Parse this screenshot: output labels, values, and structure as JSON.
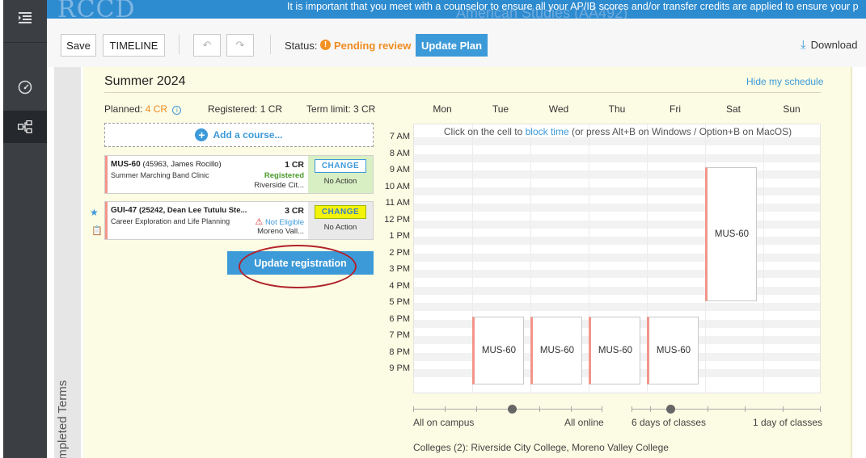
{
  "banner": {
    "logo": "RCCD",
    "ghost_title": "American Studies (AA492)",
    "message": "It is important that you meet with a counselor to ensure all your AP/IB scores and/or transfer credits are applied to ensure your p"
  },
  "rail": {
    "icons": [
      "menu-list-icon",
      "dashboard-gauge-icon",
      "plan-tree-icon"
    ]
  },
  "toolbar": {
    "save_label": "Save",
    "timeline_label": "TIMELINE",
    "undo_icon": "undo-icon",
    "redo_icon": "redo-icon",
    "status_label": "Status:",
    "status_value": "Pending review",
    "status_color": "#f39224",
    "update_plan_label": "Update Plan",
    "download_label": "Download"
  },
  "completed_terms_label": "Completed Terms",
  "term": {
    "title": "Summer 2024",
    "hide_schedule_label": "Hide my schedule",
    "planned_label": "Planned:",
    "planned_value": "4 CR",
    "registered_label": "Registered: 1 CR",
    "term_limit_label": "Term limit: 3 CR",
    "add_course_label": "Add a course...",
    "update_registration_label": "Update registration"
  },
  "courses": [
    {
      "code": "MUS-60",
      "detail": "(45963, James Rocillo)",
      "title": "Summer Marching Band Clinic",
      "credits": "1 CR",
      "status": "Registered",
      "campus": "Riverside Cit...",
      "change_label": "CHANGE",
      "action_label": "No Action"
    },
    {
      "code": "GUI-47",
      "detail": "(25242, Dean Lee Tutulu Ste...",
      "title": "Career Exploration and Life Planning",
      "credits": "3 CR",
      "status": "Not Eligible",
      "campus": "Moreno Vall...",
      "change_label": "CHANGE",
      "action_label": "No Action"
    }
  ],
  "schedule": {
    "days": [
      "Mon",
      "Tue",
      "Wed",
      "Thu",
      "Fri",
      "Sat",
      "Sun"
    ],
    "hours": [
      "7 AM",
      "8 AM",
      "9 AM",
      "10 AM",
      "11 AM",
      "12 PM",
      "1 PM",
      "2 PM",
      "3 PM",
      "4 PM",
      "5 PM",
      "6 PM",
      "7 PM",
      "8 PM",
      "9 PM"
    ],
    "hint_prefix": "Click on the cell to",
    "hint_link": "block time",
    "hint_suffix": "(or press Alt+B on Windows / Option+B on MacOS)",
    "blocks": [
      {
        "label": "MUS-60",
        "day": "Tue",
        "start": "6 PM",
        "end": "10 PM"
      },
      {
        "label": "MUS-60",
        "day": "Wed",
        "start": "6 PM",
        "end": "10 PM"
      },
      {
        "label": "MUS-60",
        "day": "Thu",
        "start": "6 PM",
        "end": "10 PM"
      },
      {
        "label": "MUS-60",
        "day": "Fri",
        "start": "6 PM",
        "end": "10 PM"
      },
      {
        "label": "MUS-60",
        "day": "Sat",
        "start": "9 AM",
        "end": "5 PM"
      }
    ]
  },
  "filters": {
    "campus_left": "All on campus",
    "campus_right": "All online",
    "days_left": "6 days of classes",
    "days_right": "1 day of classes",
    "colleges": "Colleges (2): Riverside City College, Moreno Valley College"
  }
}
